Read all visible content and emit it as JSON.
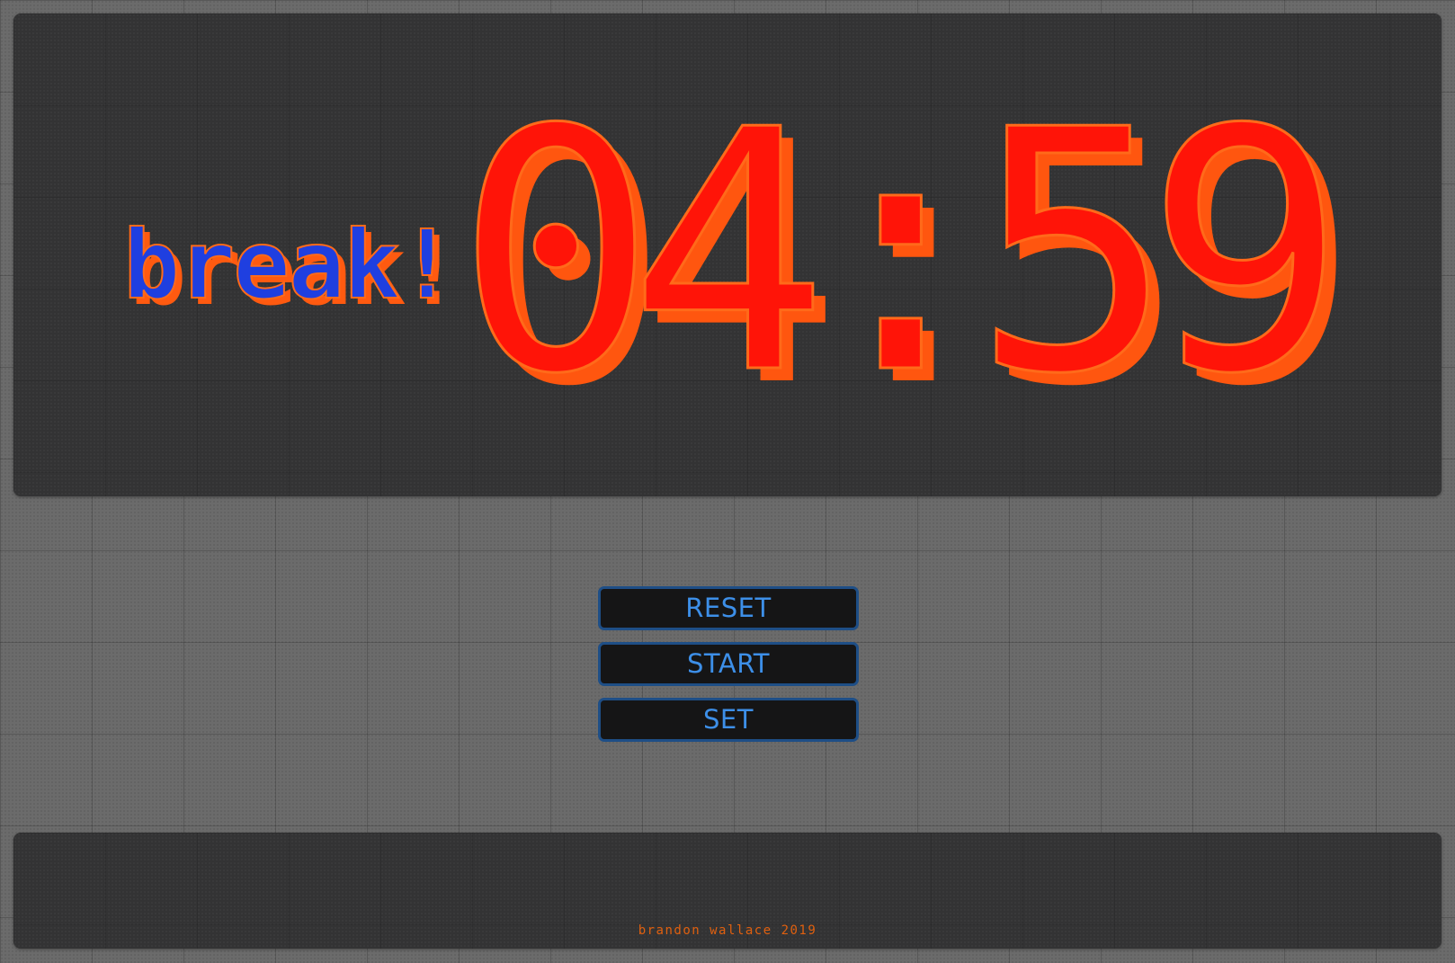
{
  "timer": {
    "mode_label": "break!",
    "time": "04:59"
  },
  "controls": {
    "reset_label": "RESET",
    "start_label": "START",
    "set_label": "SET"
  },
  "footer": {
    "credit": "brandon wallace 2019"
  },
  "colors": {
    "page_background": "#6b6b6b",
    "panel_background": "#333334",
    "time_digits": "#ff1408",
    "time_shadow": "#ff560f",
    "mode_label": "#1f3fe0",
    "button_text": "#3d8fe8",
    "button_border": "#1e4e86",
    "credit_text": "#e0600f"
  }
}
